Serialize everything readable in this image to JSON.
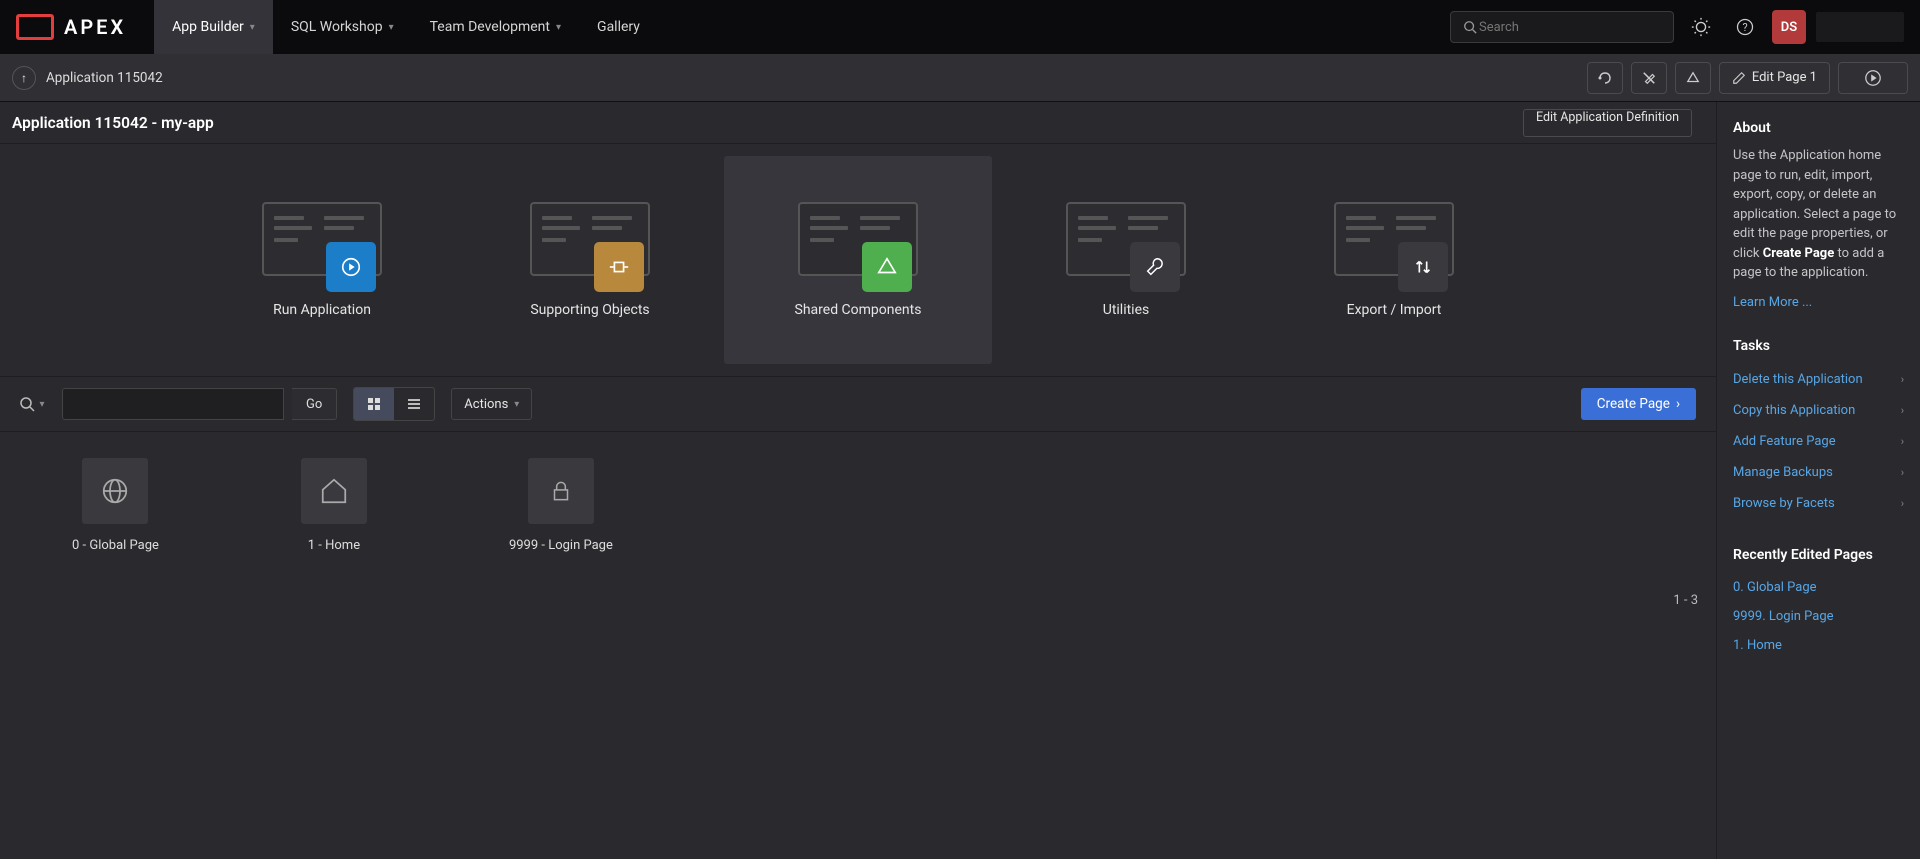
{
  "brand": "APEX",
  "topnav": {
    "items": [
      "App Builder",
      "SQL Workshop",
      "Team Development",
      "Gallery"
    ],
    "active_index": 0,
    "search_placeholder": "Search",
    "user_initials": "DS"
  },
  "subbar": {
    "breadcrumb": "Application 115042",
    "edit_page_label": "Edit Page 1"
  },
  "titlebar": {
    "title": "Application 115042 - my-app",
    "edit_def_label": "Edit Application Definition"
  },
  "action_cards": [
    {
      "label": "Run Application",
      "icon": "play",
      "badge_class": "card-icon-run"
    },
    {
      "label": "Supporting Objects",
      "icon": "plugin",
      "badge_class": "card-icon-obj"
    },
    {
      "label": "Shared Components",
      "icon": "share",
      "badge_class": "card-icon-share",
      "hover": true
    },
    {
      "label": "Utilities",
      "icon": "wrench",
      "badge_class": "card-icon-util"
    },
    {
      "label": "Export / Import",
      "icon": "updown",
      "badge_class": "card-icon-exp"
    }
  ],
  "filterbar": {
    "go_label": "Go",
    "actions_label": "Actions",
    "create_page_label": "Create Page"
  },
  "pages": [
    {
      "label": "0 - Global Page",
      "icon": "globe"
    },
    {
      "label": "1 - Home",
      "icon": "home"
    },
    {
      "label": "9999 - Login Page",
      "icon": "lock"
    }
  ],
  "row_count": "1 - 3",
  "sidepanel": {
    "about_heading": "About",
    "about_text_1": "Use the Application home page to run, edit, import, export, copy, or delete an application. Select a page to edit the page properties, or click ",
    "about_strong": "Create Page",
    "about_text_2": " to add a page to the application.",
    "learn_more": "Learn More ...",
    "tasks_heading": "Tasks",
    "tasks": [
      "Delete this Application",
      "Copy this Application",
      "Add Feature Page",
      "Manage Backups",
      "Browse by Facets"
    ],
    "recent_heading": "Recently Edited Pages",
    "recent": [
      "0. Global Page",
      "9999. Login Page",
      "1. Home"
    ]
  }
}
